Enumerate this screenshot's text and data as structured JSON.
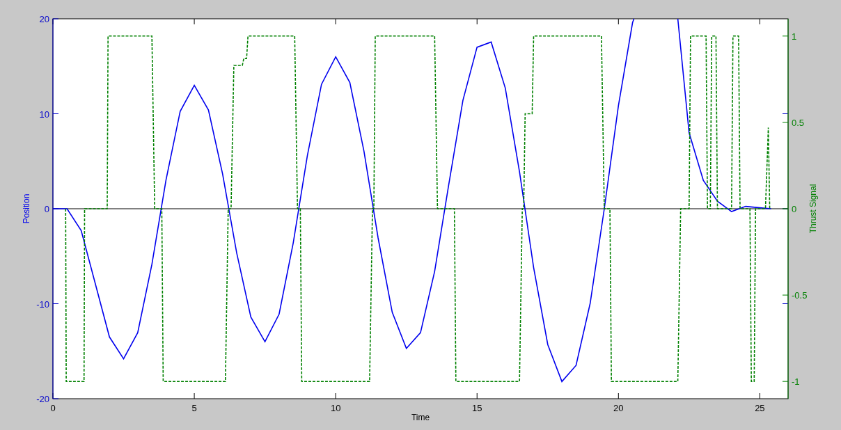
{
  "figure": {
    "position_axes": {
      "chart_data": {
        "type": "line",
        "xlabel": "Time",
        "xlim": [
          0,
          26
        ],
        "ylim": [
          -20,
          20
        ],
        "xticks": [
          0,
          5,
          10,
          15,
          20,
          25
        ],
        "yticks": [
          -20,
          -10,
          0,
          10,
          20
        ],
        "x": [
          0,
          0.5,
          1,
          1.5,
          2,
          2.5,
          3,
          3.5,
          4,
          4.5,
          5,
          5.5,
          6,
          6.5,
          7,
          7.5,
          8,
          8.5,
          9,
          9.5,
          10,
          10.5,
          11,
          11.5,
          12,
          12.5,
          13,
          13.5,
          14,
          14.5,
          15,
          15.5,
          16,
          16.5,
          17,
          17.5,
          18,
          18.5,
          19,
          19.5,
          20,
          20.5,
          20.55,
          21.2,
          22.1,
          22.5,
          23,
          23.5,
          24,
          24.5,
          25,
          25.4
        ],
        "series": [
          {
            "name": "Position",
            "color": "#0000ee",
            "line_style": "solid",
            "values": [
              0,
              0,
              -2.3,
              -7.9,
              -13.5,
              -15.8,
              -13.05,
              -5.85,
              3.05,
              10.25,
              13,
              10.4,
              3.67,
              -4.67,
              -11.4,
              -14,
              -11.1,
              -3.6,
              5.6,
              13.1,
              16,
              13.3,
              6.05,
              -3.08,
              -10.9,
              -14.7,
              -13.05,
              -6.6,
              2.55,
              11.4,
              17,
              17.55,
              12.7,
              3.9,
              -6.2,
              -14.3,
              -18.2,
              -16.5,
              -9.96,
              0,
              10.85,
              19.6,
              20,
              null,
              20,
              8,
              3,
              0.8,
              -0.3,
              0.25,
              0.1,
              0
            ]
          }
        ]
      }
    },
    "thrust_axes": {
      "chart_data": {
        "type": "line",
        "xlim": [
          0,
          26
        ],
        "ylim": [
          -1.1,
          1.1
        ],
        "yticks": [
          -1,
          -0.5,
          0,
          0.5,
          1
        ],
        "x": [
          0.45,
          0.47,
          1.1,
          1.12,
          1.92,
          1.95,
          3.5,
          3.6,
          3.85,
          3.9,
          6.1,
          6.2,
          6.3,
          6.4,
          6.7,
          6.75,
          6.85,
          6.9,
          8.55,
          8.65,
          8.75,
          8.8,
          11.2,
          11.3,
          11.35,
          11.4,
          13.5,
          13.6,
          14.2,
          14.25,
          16.5,
          16.6,
          16.65,
          16.7,
          16.95,
          17.0,
          19.4,
          19.5,
          19.7,
          19.75,
          22.1,
          22.2,
          22.5,
          22.55,
          23.1,
          23.15,
          23.25,
          23.3,
          23.45,
          23.5,
          24.0,
          24.05,
          24.25,
          24.3,
          24.65,
          24.7,
          24.8,
          24.85,
          25.2,
          25.3,
          25.35
        ],
        "series": [
          {
            "name": "Thrust Signal",
            "color": "#008000",
            "line_style": "dashed",
            "values": [
              0,
              -1,
              -1,
              0,
              0,
              1,
              1,
              0,
              0,
              -1,
              -1,
              0,
              0,
              0.83,
              0.83,
              0.87,
              0.87,
              1,
              1,
              0,
              0,
              -1,
              -1,
              0,
              0,
              1,
              1,
              0,
              0,
              -1,
              -1,
              0,
              0,
              0.55,
              0.55,
              1,
              1,
              0,
              0,
              -1,
              -1,
              0,
              0,
              1,
              1,
              0,
              0,
              1,
              1,
              0,
              0,
              1,
              1,
              0,
              0,
              -1,
              -1,
              0,
              0,
              0.47,
              0
            ]
          }
        ]
      }
    }
  }
}
